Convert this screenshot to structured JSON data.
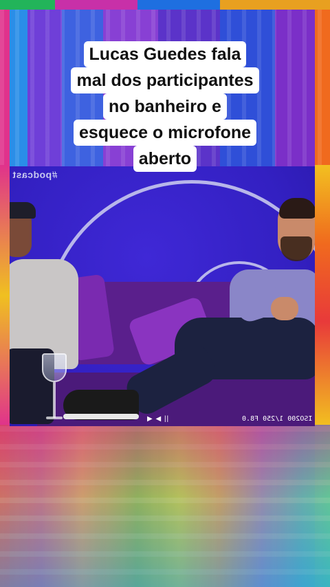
{
  "caption": {
    "lines": [
      "Lucas Guedes fala",
      "mal dos participantes",
      "no banheiro e",
      "esquece o microfone",
      "aberto"
    ]
  },
  "video": {
    "watermark": "#podcast",
    "controls": "▶ ◀ ||",
    "camera_readout": "ISO200  1/250 F8.0"
  }
}
